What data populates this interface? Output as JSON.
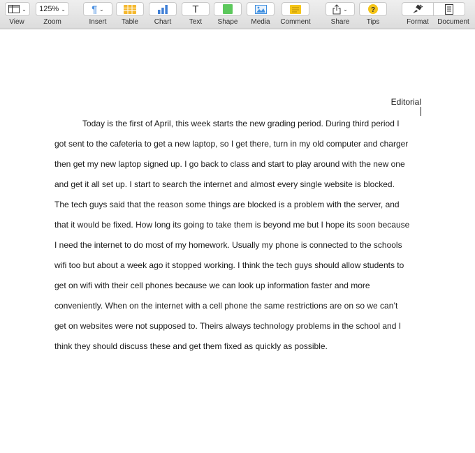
{
  "toolbar": {
    "view_label": "View",
    "zoom_value": "125%",
    "zoom_label": "Zoom",
    "insert_label": "Insert",
    "table_label": "Table",
    "chart_label": "Chart",
    "text_label": "Text",
    "shape_label": "Shape",
    "media_label": "Media",
    "comment_label": "Comment",
    "share_label": "Share",
    "tips_label": "Tips",
    "format_label": "Format",
    "document_label": "Document",
    "icons": {
      "view": "sidebar-view-icon",
      "insert": "paragraph-icon",
      "table": "table-icon",
      "chart": "bar-chart-icon",
      "text": "text-icon",
      "shape": "shape-icon",
      "media": "image-icon",
      "comment": "comment-icon",
      "share": "share-icon",
      "tips": "question-icon",
      "format": "paintbrush-icon",
      "document": "document-icon"
    },
    "colors": {
      "insert_accent": "#4a90e2",
      "table_accent": "#f5b82e",
      "chart_accent": "#3f7fd6",
      "shape_accent": "#5cc85c",
      "media_accent": "#3f8fe0",
      "comment_accent": "#f5c518",
      "tips_accent": "#f5c518"
    }
  },
  "document": {
    "header": "Editorial",
    "lines": [
      "Today is the first of April, this week starts the new grading period. During third period I",
      "got sent to the cafeteria to get a new laptop, so I get there, turn in my old computer and charger",
      "then get my new laptop signed up. I go back to class and start to play around with the new one",
      "and get it all set up. I start to search the internet and almost every single website is blocked.",
      "The tech guys said that the reason some things are blocked is a problem with the server, and",
      "that it would be fixed. How long its going to take them is beyond me but I hope its soon because",
      "I need the internet to do most of my homework. Usually my phone is connected to the schools",
      "wifi too but about a week ago it stopped working. I think the tech guys should allow students to",
      "get on wifi with their cell phones because we can look up information faster and more",
      "conveniently. When on the internet with a cell phone the same restrictions are on so we can’t",
      "get on websites were not supposed to. Theirs always technology problems in the school and I",
      "think they should discuss these and get them fixed as quickly as possible."
    ]
  }
}
